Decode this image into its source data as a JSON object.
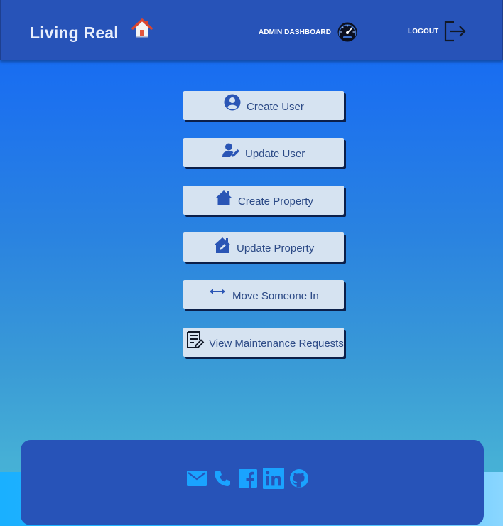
{
  "header": {
    "brand": "Living Real",
    "brand_icon": "house-icon",
    "nav_dashboard": "ADMIN DASHBOARD",
    "nav_dashboard_icon": "speedometer-icon",
    "nav_logout": "LOGOUT",
    "nav_logout_icon": "logout-icon"
  },
  "menu": {
    "items": [
      {
        "label": "Create User",
        "icon": "user-circle-icon"
      },
      {
        "label": "Update User",
        "icon": "user-edit-icon"
      },
      {
        "label": "Create Property",
        "icon": "home-icon"
      },
      {
        "label": "Update Property",
        "icon": "home-edit-icon"
      },
      {
        "label": "Move Someone In",
        "icon": "arrows-horizontal-icon"
      },
      {
        "label": "View Maintenance Requests",
        "icon": "document-edit-icon"
      }
    ]
  },
  "footer": {
    "social": [
      "email-icon",
      "phone-icon",
      "facebook-icon",
      "linkedin-icon",
      "github-icon"
    ]
  },
  "colors": {
    "header_bg": "#2753b8",
    "button_bg": "#d6e3f1",
    "button_text": "#2c4a86",
    "icon_blue": "#2a55b5",
    "footer_icon": "#1aa3ff"
  }
}
